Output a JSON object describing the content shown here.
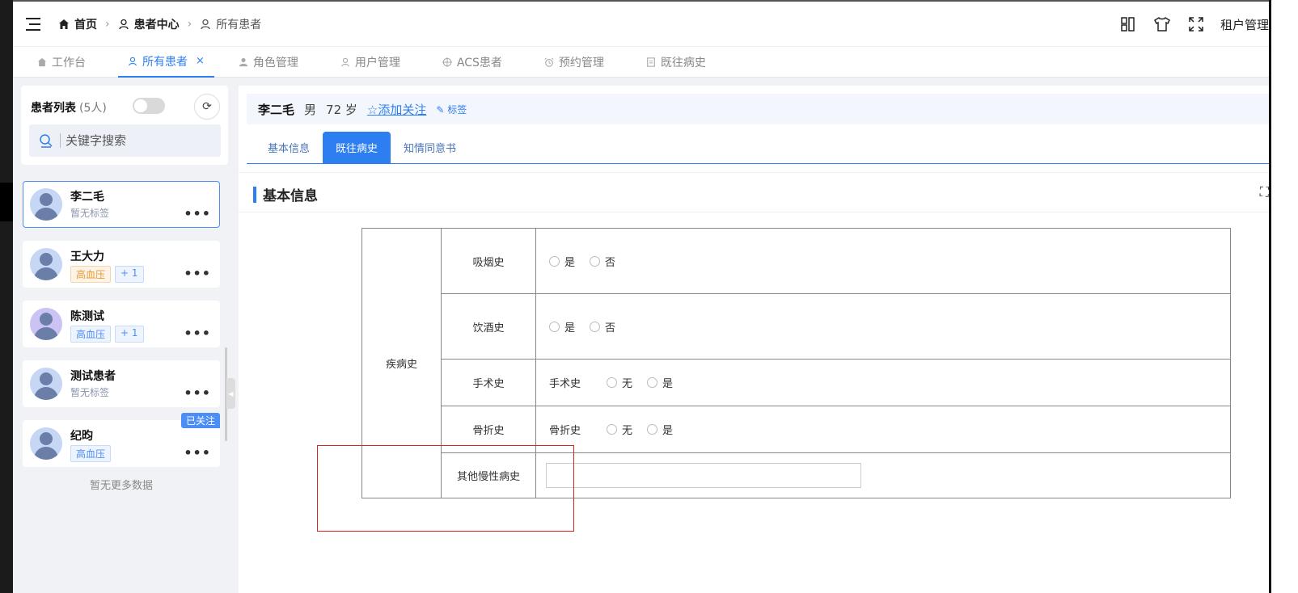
{
  "breadcrumbs": [
    "首页",
    "患者中心",
    "所有患者"
  ],
  "header": {
    "tenant": "租户管理"
  },
  "page_tabs": [
    {
      "label": "工作台",
      "icon": "home-icon",
      "active": false
    },
    {
      "label": "所有患者",
      "icon": "user-icon",
      "active": true
    },
    {
      "label": "角色管理",
      "icon": "person-icon",
      "active": false
    },
    {
      "label": "用户管理",
      "icon": "user-icon",
      "active": false
    },
    {
      "label": "ACS患者",
      "icon": "crosshair-icon",
      "active": false
    },
    {
      "label": "预约管理",
      "icon": "alarm-icon",
      "active": false
    },
    {
      "label": "既往病史",
      "icon": "document-icon",
      "active": false
    }
  ],
  "sidebar": {
    "title": "患者列表",
    "count": "(5人)",
    "search_placeholder": "关键字搜索",
    "patients": [
      {
        "name": "李二毛",
        "no_tag": "暂无标签"
      },
      {
        "name": "王大力",
        "tag": "高血压",
        "extra": "+ 1"
      },
      {
        "name": "陈测试",
        "tag": "高血压",
        "extra": "+ 1"
      },
      {
        "name": "测试患者",
        "no_tag": "暂无标签"
      },
      {
        "name": "纪昀",
        "tag": "高血压",
        "badge": "已关注"
      }
    ],
    "no_more": "暂无更多数据"
  },
  "patient": {
    "name": "李二毛",
    "gender": "男",
    "age": "72 岁",
    "follow": "☆添加关注",
    "tag_link": "标签"
  },
  "sub_tabs": [
    "基本信息",
    "既往病史",
    "知情同意书"
  ],
  "section_title": "基本信息",
  "history": {
    "category": "疾病史",
    "rows": [
      {
        "item": "吸烟史",
        "options": [
          "是",
          "否"
        ]
      },
      {
        "item": "饮酒史",
        "options": [
          "是",
          "否"
        ]
      },
      {
        "item": "手术史",
        "label": "手术史",
        "options": [
          "无",
          "是"
        ]
      },
      {
        "item": "骨折史",
        "label": "骨折史",
        "options": [
          "无",
          "是"
        ]
      },
      {
        "item": "其他慢性病史",
        "input_value": ""
      }
    ]
  }
}
